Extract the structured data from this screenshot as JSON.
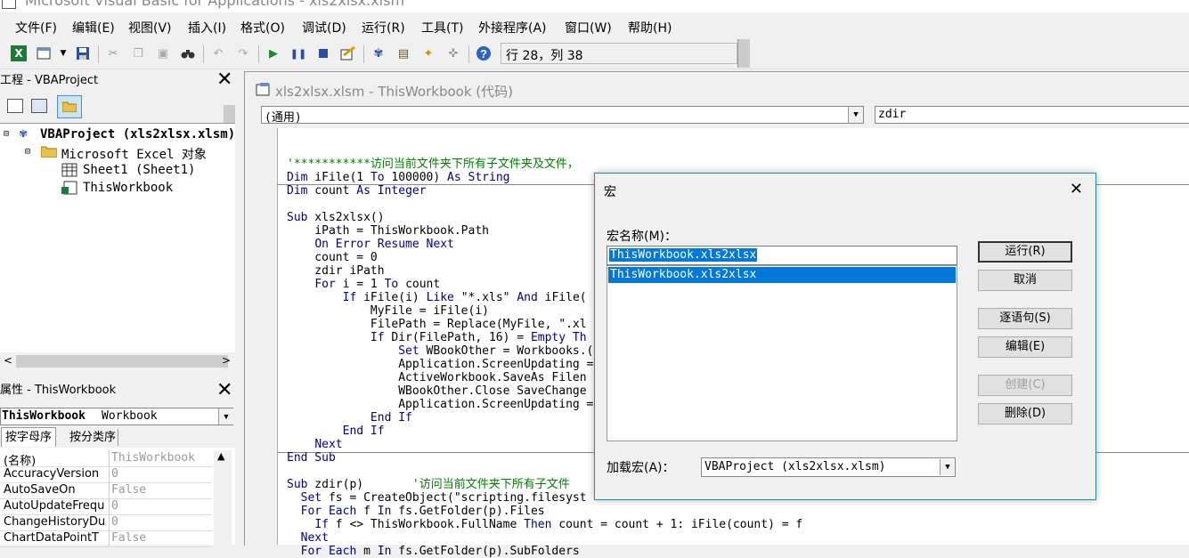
{
  "window": {
    "title": "Microsoft Visual Basic for Applications - xls2xlsx.xlsm"
  },
  "menu": [
    "文件(F)",
    "编辑(E)",
    "视图(V)",
    "插入(I)",
    "格式(O)",
    "调试(D)",
    "运行(R)",
    "工具(T)",
    "外接程序(A)",
    "窗口(W)",
    "帮助(H)"
  ],
  "toolbar": {
    "status": "行 28，列 38"
  },
  "project": {
    "title": "工程 - VBAProject",
    "tree": {
      "root": "VBAProject (xls2xlsx.xlsm)",
      "folder": "Microsoft Excel 对象",
      "sheet": "Sheet1 (Sheet1)",
      "workbook": "ThisWorkbook"
    }
  },
  "properties": {
    "title": "属性 - ThisWorkbook",
    "object_name": "ThisWorkbook",
    "object_type": "Workbook",
    "tabs": [
      "按字母序",
      "按分类序"
    ],
    "rows": [
      {
        "key": "(名称)",
        "value": "ThisWorkbook"
      },
      {
        "key": "AccuracyVersion",
        "value": "0"
      },
      {
        "key": "AutoSaveOn",
        "value": "False"
      },
      {
        "key": "AutoUpdateFrequ",
        "value": "0"
      },
      {
        "key": "ChangeHistoryDu",
        "value": "0"
      },
      {
        "key": "ChartDataPointT",
        "value": "False"
      }
    ]
  },
  "code_window": {
    "title": "xls2xlsx.xlsm - ThisWorkbook (代码)",
    "object_combo": "(通用)",
    "proc_combo": "zdir",
    "lines": [
      "'***********访问当前文件夹下所有子文件夹及文件，",
      "Dim iFile(1 To 100000) As String",
      "Dim count As Integer",
      "",
      "Sub xls2xlsx()",
      "    iPath = ThisWorkbook.Path",
      "    On Error Resume Next",
      "    count = 0",
      "    zdir iPath",
      "    For i = 1 To count",
      "        If iFile(i) Like \"*.xls\" And iFile(",
      "            MyFile = iFile(i)",
      "            FilePath = Replace(MyFile, \".xl",
      "            If Dir(FilePath, 16) = Empty Th",
      "                Set WBookOther = Workbooks.(",
      "                Application.ScreenUpdating =",
      "                ActiveWorkbook.SaveAs Filen",
      "                WBookOther.Close SaveChange",
      "                Application.ScreenUpdating =",
      "            End If",
      "        End If",
      "    Next",
      "End Sub",
      "",
      "Sub zdir(p)       '访问当前文件夹下所有子文件",
      "  Set fs = CreateObject(\"scripting.filesyst",
      "  For Each f In fs.GetFolder(p).Files",
      "    If f <> ThisWorkbook.FullName Then count = count + 1: iFile(count) = f",
      "  Next",
      "  For Each m In fs.GetFolder(p).SubFolders"
    ]
  },
  "macro_dialog": {
    "title": "宏",
    "name_label": "宏名称(M)：",
    "name_value": "ThisWorkbook.xls2xlsx",
    "list": [
      "ThisWorkbook.xls2xlsx"
    ],
    "buttons": {
      "run": "运行(R)",
      "cancel": "取消",
      "step": "逐语句(S)",
      "edit": "编辑(E)",
      "create": "创建(C)",
      "delete": "删除(D)"
    },
    "location_label": "加载宏(A)：",
    "location_value": "VBAProject (xls2xlsx.xlsm)"
  },
  "colors": {
    "selection": "#0078d7",
    "keyword": "#00008b",
    "comment": "#008000",
    "dialog_border": "#1e8fa8"
  }
}
